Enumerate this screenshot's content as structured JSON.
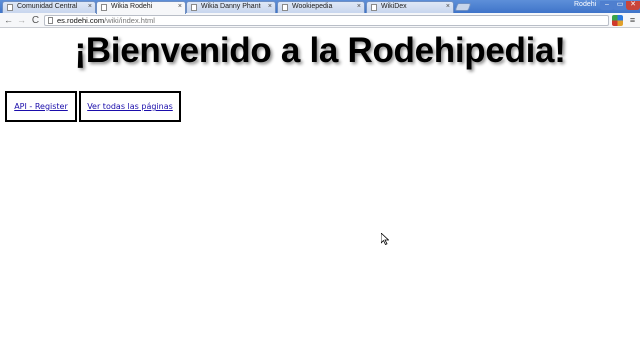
{
  "browser": {
    "tabs": [
      {
        "label": "Comunidad Central",
        "active": false
      },
      {
        "label": "Wikia Rodehi",
        "active": true
      },
      {
        "label": "Wikia Danny Phantom",
        "active": false
      },
      {
        "label": "Wookiepedia",
        "active": false
      },
      {
        "label": "WikiDex",
        "active": false
      }
    ],
    "close_glyph": "×",
    "profile_name": "Rodehi",
    "window_buttons": {
      "minimize": "–",
      "maximize": "▭",
      "close": "✕"
    },
    "toolbar": {
      "back": "←",
      "forward": "→",
      "reload": "C",
      "url_domain": "es.rodehi.com",
      "url_path": "/wiki/index.html",
      "menu": "≡"
    }
  },
  "page": {
    "title": "¡Bienvenido a la Rodehipedia!",
    "links": [
      {
        "label": "API - Register"
      },
      {
        "label": "Ver todas las páginas"
      }
    ]
  },
  "colors": {
    "tabstrip": "#3f74c9",
    "link": "#1a0dab",
    "close_button": "#c9453a"
  }
}
